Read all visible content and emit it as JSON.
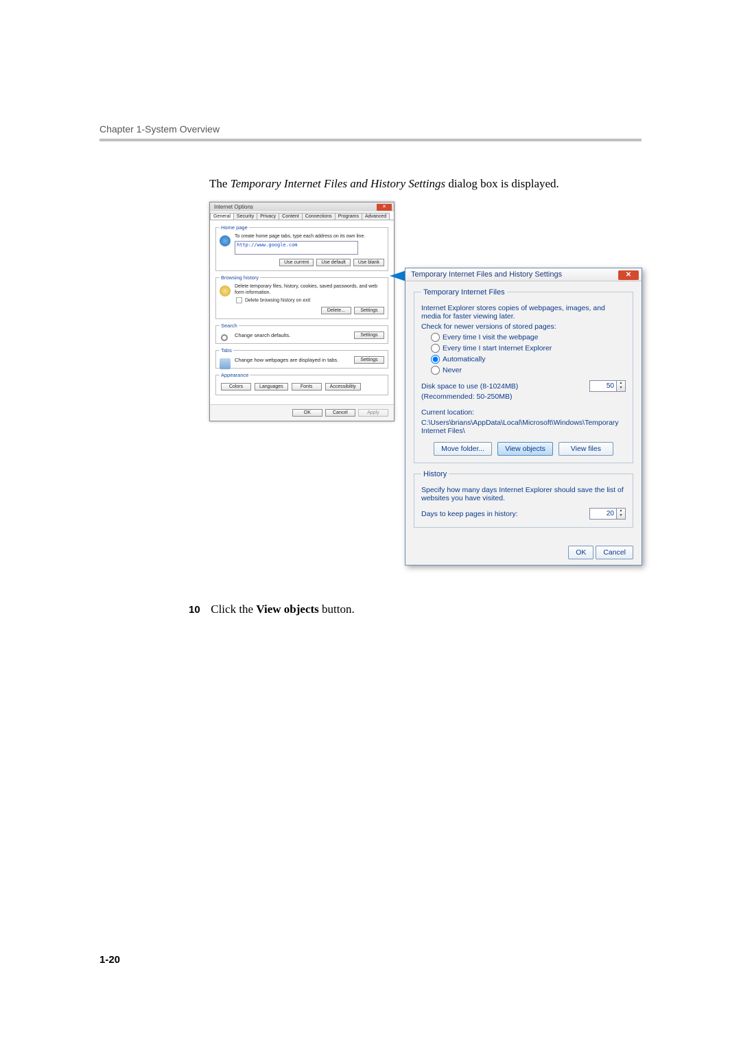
{
  "header": {
    "chapter": "Chapter 1-System Overview"
  },
  "intro": {
    "pre": "The ",
    "italic": "Temporary Internet Files and History Settings",
    "post": " dialog box is displayed."
  },
  "io": {
    "title": "Internet Options",
    "tabs": [
      "General",
      "Security",
      "Privacy",
      "Content",
      "Connections",
      "Programs",
      "Advanced"
    ],
    "home": {
      "legend": "Home page",
      "text": "To create home page tabs, type each address on its own line.",
      "url": "http://www.google.com",
      "btns": [
        "Use current",
        "Use default",
        "Use blank"
      ]
    },
    "history": {
      "legend": "Browsing history",
      "text": "Delete temporary files, history, cookies, saved passwords, and web form information.",
      "chk": "Delete browsing history on exit",
      "btns": [
        "Delete...",
        "Settings"
      ]
    },
    "search": {
      "legend": "Search",
      "text": "Change search defaults.",
      "btn": "Settings"
    },
    "tabsGroup": {
      "legend": "Tabs",
      "text": "Change how webpages are displayed in tabs.",
      "btn": "Settings"
    },
    "appearance": {
      "legend": "Appearance",
      "btns": [
        "Colors",
        "Languages",
        "Fonts",
        "Accessibility"
      ]
    },
    "footer": [
      "OK",
      "Cancel",
      "Apply"
    ]
  },
  "tif": {
    "title": "Temporary Internet Files and History Settings",
    "files": {
      "legend": "Temporary Internet Files",
      "desc": "Internet Explorer stores copies of webpages, images, and media for faster viewing later.",
      "check": "Check for newer versions of stored pages:",
      "radios": [
        "Every time I visit the webpage",
        "Every time I start Internet Explorer",
        "Automatically",
        "Never"
      ],
      "disk1": "Disk space to use (8-1024MB)",
      "disk2": "(Recommended: 50-250MB)",
      "diskval": "50",
      "loc_label": "Current location:",
      "loc_path": "C:\\Users\\brians\\AppData\\Local\\Microsoft\\Windows\\Temporary Internet Files\\",
      "btns": [
        "Move folder...",
        "View objects",
        "View files"
      ]
    },
    "hist": {
      "legend": "History",
      "desc": "Specify how many days Internet Explorer should save the list of websites you have visited.",
      "days_label": "Days to keep pages in history:",
      "days_val": "20"
    },
    "footer": [
      "OK",
      "Cancel"
    ]
  },
  "step": {
    "num": "10",
    "pre": "Click the ",
    "bold": "View objects",
    "post": " button."
  },
  "footer": {
    "pagenum": "1-20"
  }
}
